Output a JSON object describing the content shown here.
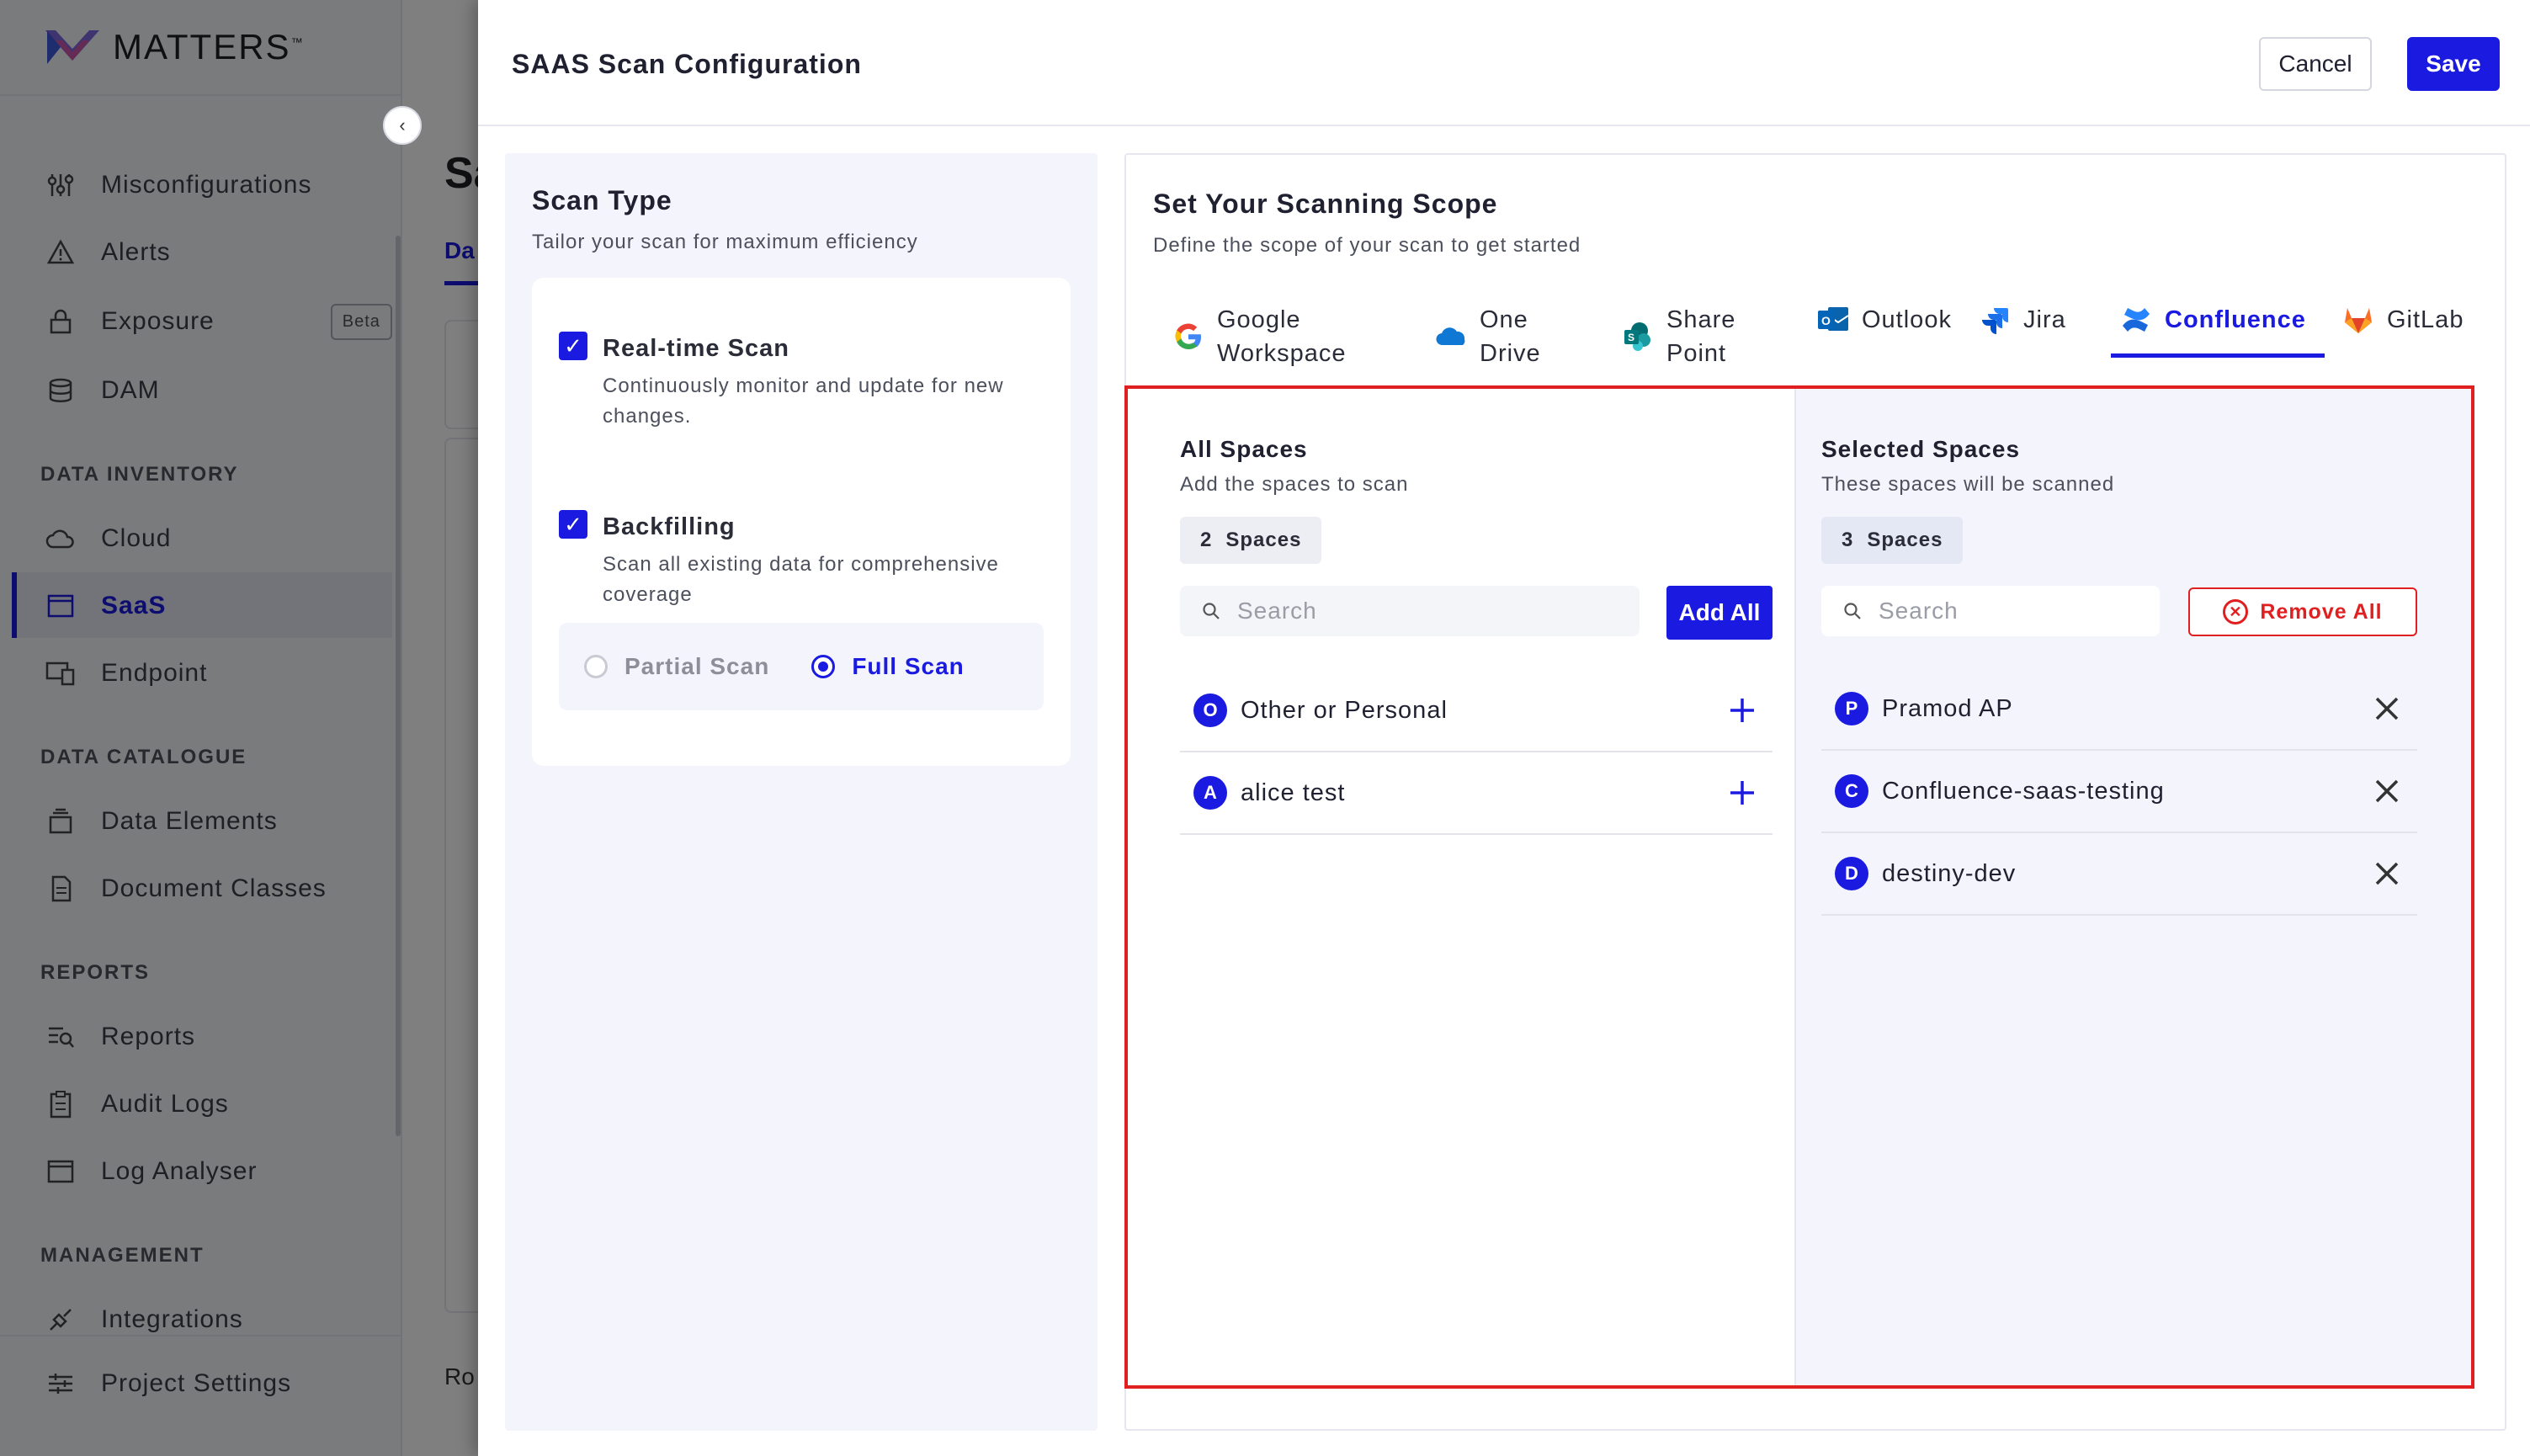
{
  "app": {
    "logo_text": "MATTERS",
    "logo_tm": "™",
    "page_title": "Sa",
    "page_tab": "Da",
    "rows_label": "Ro",
    "sidebar": {
      "items": [
        {
          "label": "Misconfigurations",
          "icon": "sliders-icon"
        },
        {
          "label": "Alerts",
          "icon": "warning-icon"
        },
        {
          "label": "Exposure",
          "icon": "lock-icon",
          "badge": "Beta"
        },
        {
          "label": "DAM",
          "icon": "database-icon"
        }
      ],
      "sections": [
        {
          "title": "DATA INVENTORY",
          "items": [
            {
              "label": "Cloud",
              "icon": "cloud-icon"
            },
            {
              "label": "SaaS",
              "icon": "window-icon",
              "active": true
            },
            {
              "label": "Endpoint",
              "icon": "devices-icon"
            }
          ]
        },
        {
          "title": "DATA CATALOGUE",
          "items": [
            {
              "label": "Data Elements",
              "icon": "stack-icon"
            },
            {
              "label": "Document Classes",
              "icon": "document-icon"
            }
          ]
        },
        {
          "title": "REPORTS",
          "items": [
            {
              "label": "Reports",
              "icon": "report-icon"
            },
            {
              "label": "Audit Logs",
              "icon": "clipboard-icon"
            },
            {
              "label": "Log Analyser",
              "icon": "window-icon"
            }
          ]
        },
        {
          "title": "MANAGEMENT",
          "items": [
            {
              "label": "Integrations",
              "icon": "plug-icon"
            }
          ]
        }
      ],
      "footer_item": {
        "label": "Project Settings",
        "icon": "settings-sliders-icon"
      }
    }
  },
  "drawer": {
    "title": "SAAS Scan Configuration",
    "cancel_label": "Cancel",
    "save_label": "Save",
    "scan_type": {
      "title": "Scan Type",
      "subtitle": "Tailor your scan for maximum efficiency",
      "options": [
        {
          "title": "Real-time Scan",
          "desc": "Continuously monitor and update for new changes.",
          "checked": true
        },
        {
          "title": "Backfilling",
          "desc": "Scan all existing data for comprehensive coverage",
          "checked": true
        }
      ],
      "radio": [
        {
          "label": "Partial Scan",
          "selected": false
        },
        {
          "label": "Full Scan",
          "selected": true
        }
      ]
    },
    "scope": {
      "title": "Set Your Scanning Scope",
      "subtitle": "Define the scope of your scan to get started",
      "tabs": [
        {
          "line1": "Google",
          "line2": "Workspace",
          "icon": "google-icon"
        },
        {
          "line1": "One",
          "line2": "Drive",
          "icon": "onedrive-icon"
        },
        {
          "line1": "Share",
          "line2": "Point",
          "icon": "sharepoint-icon"
        },
        {
          "line1": "Outlook",
          "line2": "",
          "icon": "outlook-icon"
        },
        {
          "line1": "Jira",
          "line2": "",
          "icon": "jira-icon"
        },
        {
          "line1": "Confluence",
          "line2": "",
          "icon": "confluence-icon",
          "active": true
        },
        {
          "line1": "GitLab",
          "line2": "",
          "icon": "gitlab-icon"
        }
      ],
      "all_spaces": {
        "title": "All Spaces",
        "subtitle": "Add the spaces to scan",
        "count": "2",
        "count_label": "Spaces",
        "search_placeholder": "Search",
        "add_all_label": "Add All",
        "items": [
          {
            "initial": "O",
            "name": "Other or Personal"
          },
          {
            "initial": "A",
            "name": "alice test"
          }
        ]
      },
      "selected_spaces": {
        "title": "Selected Spaces",
        "subtitle": "These spaces will be scanned",
        "count": "3",
        "count_label": "Spaces",
        "search_placeholder": "Search",
        "remove_all_label": "Remove All",
        "items": [
          {
            "initial": "P",
            "name": "Pramod AP"
          },
          {
            "initial": "C",
            "name": "Confluence-saas-testing"
          },
          {
            "initial": "D",
            "name": "destiny-dev"
          }
        ]
      }
    }
  },
  "colors": {
    "accent": "#1a1ae0",
    "danger": "#e02020",
    "panel_bg": "#f4f5fc"
  }
}
